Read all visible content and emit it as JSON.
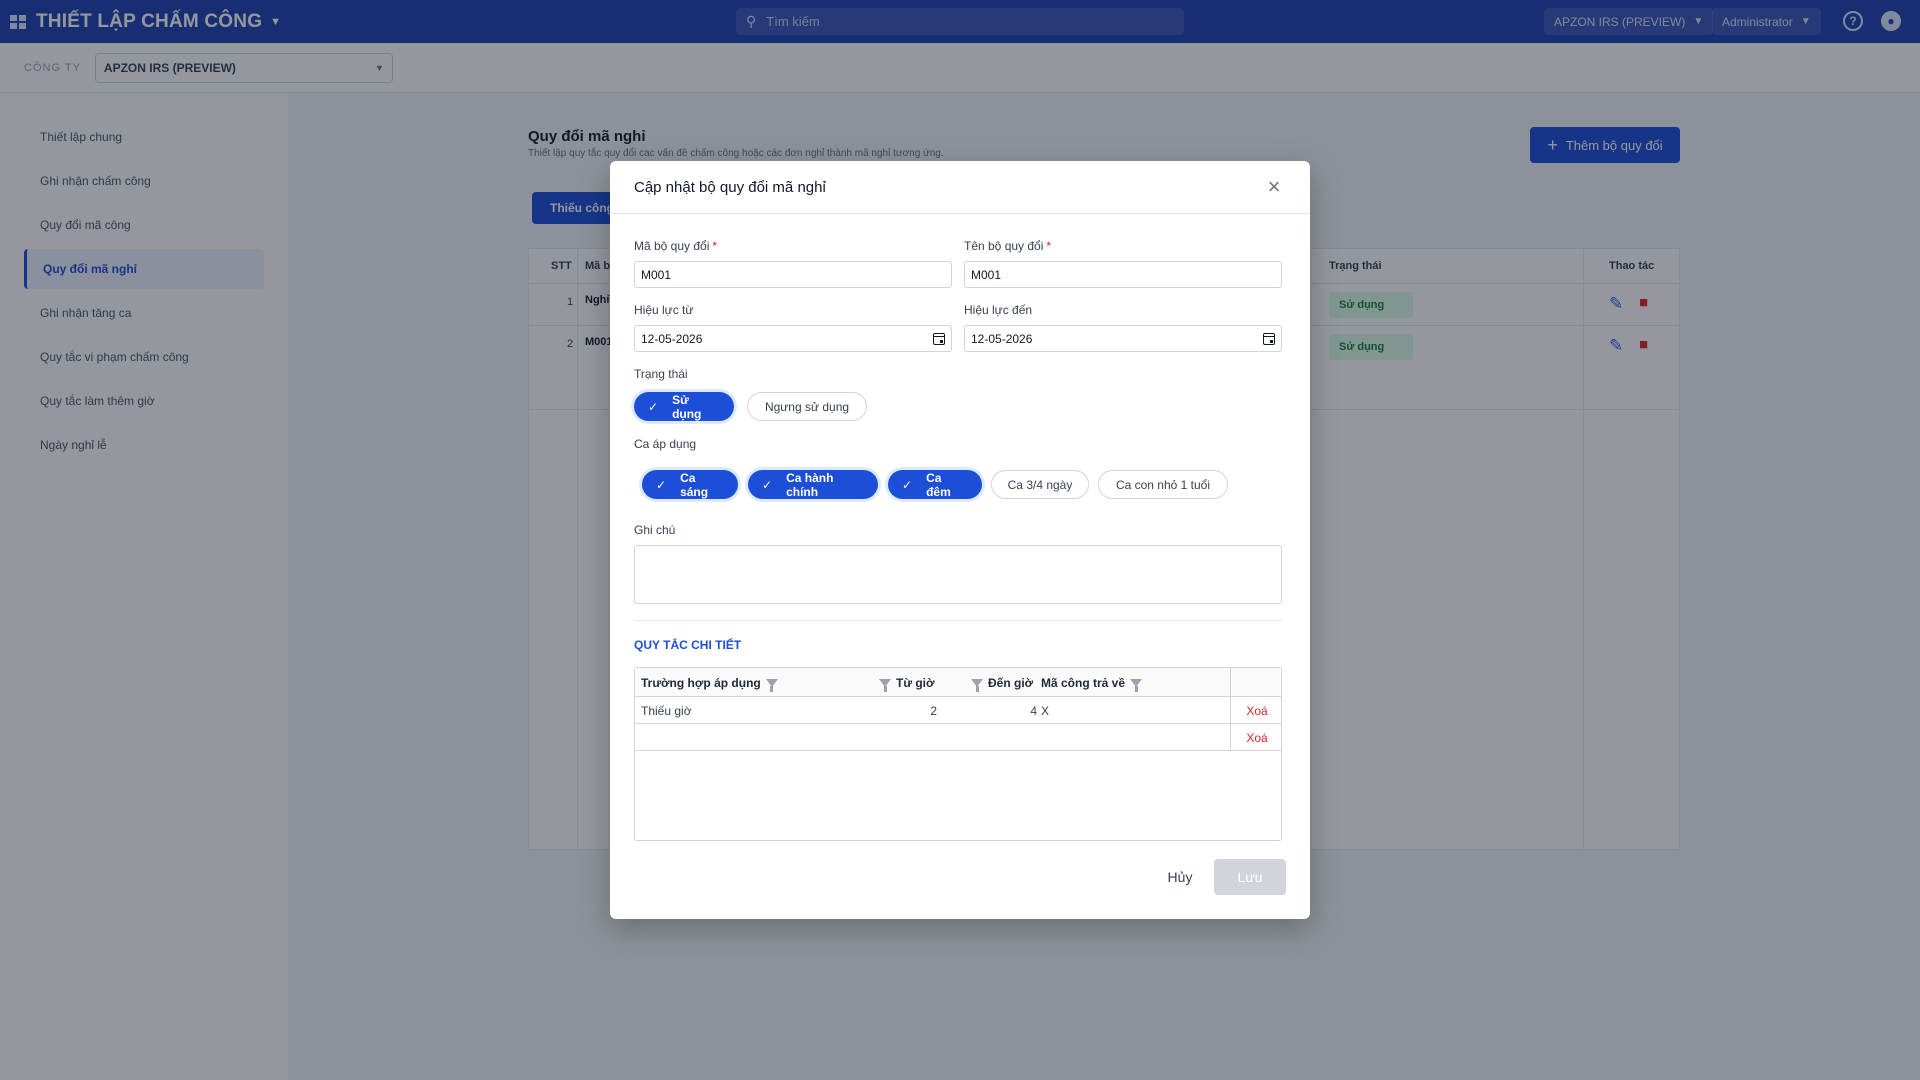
{
  "topbar": {
    "app_title": "THIẾT LẬP CHẤM CÔNG",
    "search_placeholder": "Tìm kiếm",
    "company_switch": "APZON IRS (PREVIEW)",
    "user": "Administrator"
  },
  "company": {
    "label": "CÔNG TY",
    "value": "APZON IRS (PREVIEW)"
  },
  "sidebar": {
    "items": [
      {
        "label": "Thiết lập chung"
      },
      {
        "label": "Ghi nhận chấm công"
      },
      {
        "label": "Quy đổi mã công"
      },
      {
        "label": "Quy đổi mã nghỉ"
      },
      {
        "label": "Ghi nhận tăng ca"
      },
      {
        "label": "Quy tắc vi phạm chấm công"
      },
      {
        "label": "Quy tắc làm thêm giờ"
      },
      {
        "label": "Ngày nghỉ lễ"
      }
    ]
  },
  "page": {
    "title": "Quy đổi mã nghỉ",
    "subtitle": "Thiết lập quy tắc quy đổi cac vấn đề chấm công hoặc các đơn nghỉ thành mã nghỉ tương ứng.",
    "add_button": "Thêm bộ quy đổi",
    "tab_label": "Thiếu công",
    "table": {
      "col_stt": "STT",
      "col_code": "Mã b",
      "col_status": "Trạng thái",
      "col_actions": "Thao tác",
      "rows": [
        {
          "stt": "1",
          "code": "Nghỉ",
          "status": "Sử dụng"
        },
        {
          "stt": "2",
          "code": "M001",
          "status": "Sử dụng"
        }
      ]
    }
  },
  "modal": {
    "title": "Cập nhật bộ quy đổi mã nghỉ",
    "code_label": "Mã bộ quy đổi",
    "code_value": "M001",
    "name_label": "Tên bộ quy đổi",
    "name_value": "M001",
    "required_mark": "*",
    "from_label": "Hiệu lực từ",
    "from_value": "12-05-2026",
    "to_label": "Hiệu lực đến",
    "to_value": "12-05-2026",
    "status_label": "Trạng thái",
    "status_options": [
      {
        "label": "Sử dụng",
        "selected": true
      },
      {
        "label": "Ngưng sử dụng",
        "selected": false
      }
    ],
    "shift_label": "Ca áp dụng",
    "shift_options": [
      {
        "label": "Ca sáng",
        "selected": true
      },
      {
        "label": "Ca hành chính",
        "selected": true
      },
      {
        "label": "Ca đêm",
        "selected": true
      },
      {
        "label": "Ca 3/4 ngày",
        "selected": false
      },
      {
        "label": "Ca con nhỏ 1 tuổi",
        "selected": false
      }
    ],
    "check_glyph": "✓",
    "note_label": "Ghi chú",
    "note_value": "",
    "section_title": "QUY TẮC CHI TIẾT",
    "grid": {
      "headers": {
        "case": "Trường hợp áp dụng",
        "from_hour": "Từ giờ",
        "to_hour": "Đến giờ",
        "return_code": "Mã công trả về"
      },
      "rows": [
        {
          "case": "Thiếu giờ",
          "from_hour": "2",
          "to_hour": "4",
          "return_code": "X",
          "delete": "Xoá"
        },
        {
          "case": "",
          "from_hour": "",
          "to_hour": "",
          "return_code": "",
          "delete": "Xoá"
        }
      ]
    },
    "cancel_label": "Hủy",
    "save_label": "Lưu"
  },
  "colors": {
    "primary": "#1d4ed8",
    "topbar": "#1e40af",
    "danger": "#dc2626",
    "disabled": "#d1d5db"
  }
}
